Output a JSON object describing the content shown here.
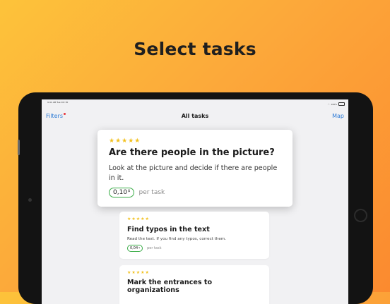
{
  "headline": "Select tasks",
  "status_bar": {
    "time": "9:41 AM  Tue Oct 30",
    "battery": "100%"
  },
  "navbar": {
    "left": "Filters",
    "title": "All tasks",
    "right": "Map"
  },
  "cards": [
    {
      "stars": "★★★★★",
      "title": "Are there people in the picture?",
      "description": "Look at the picture and decide if there are people in it.",
      "price": "0,10",
      "currency": "$",
      "per": "per task"
    },
    {
      "stars": "★★★★★",
      "title": "Find typos in the text",
      "description": "Read the text. If you find any typos, correct them.",
      "price": "0,04",
      "currency": "$",
      "per": "per task"
    },
    {
      "stars": "★★★★★",
      "title": "Mark the entrances to organizations"
    }
  ],
  "colors": {
    "accent": "#2d7bd6",
    "star": "#f2c11f",
    "price_border": "#3aac47",
    "filter_dot": "#e8333a"
  }
}
